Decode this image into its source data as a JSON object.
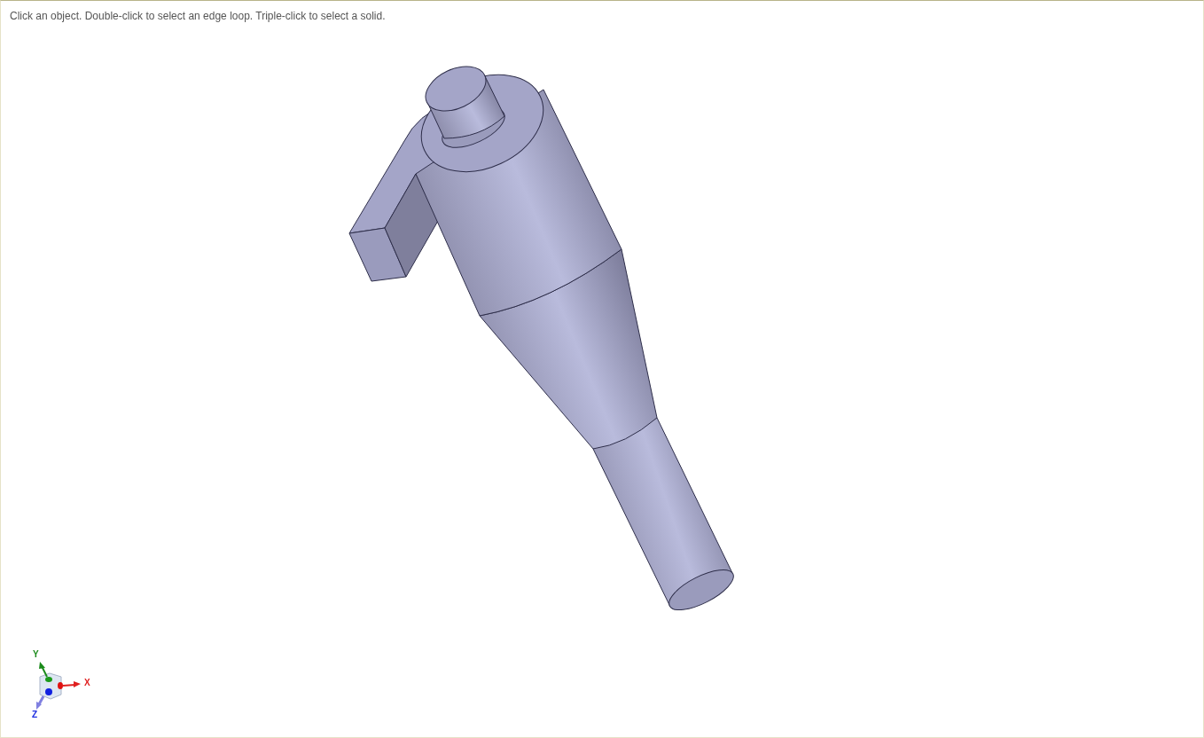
{
  "viewport": {
    "hint": "Click an object. Double-click to select an edge loop. Triple-click to select a solid.",
    "axis_labels": [
      "Y",
      "X",
      "Z"
    ]
  }
}
